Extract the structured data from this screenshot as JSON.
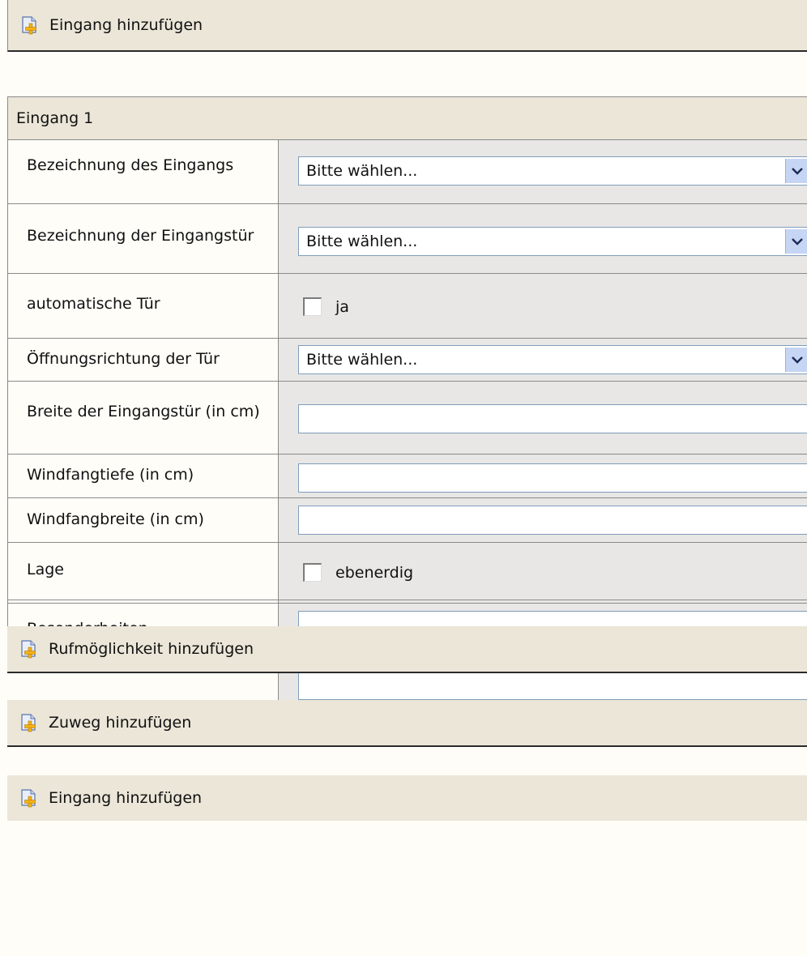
{
  "top_add": {
    "label": "Eingang hinzufügen",
    "icon": "add-document-icon"
  },
  "section": {
    "title": "Eingang 1",
    "rows": {
      "bezeichnung_eingang": {
        "label": "Bezeichnung des Eingangs",
        "value": "Bitte wählen..."
      },
      "bezeichnung_tuer": {
        "label": "Bezeichnung der Eingangstür",
        "value": "Bitte wählen..."
      },
      "automatische_tuer": {
        "label": "automatische Tür",
        "checkbox_label": "ja",
        "checked": false
      },
      "oeffnungsrichtung": {
        "label": "Öffnungsrichtung der Tür",
        "value": "Bitte wählen..."
      },
      "breite": {
        "label": "Breite der Eingangstür (in cm)",
        "value": ""
      },
      "windfangtiefe": {
        "label": "Windfangtiefe (in cm)",
        "value": ""
      },
      "windfangbreite": {
        "label": "Windfangbreite (in cm)",
        "value": ""
      },
      "lage": {
        "label": "Lage",
        "checkbox_label": "ebenerdig",
        "checked": false
      },
      "besonderheiten": {
        "label": "Besonderheiten",
        "value": ""
      }
    }
  },
  "bottom_actions": {
    "rufmoeglichkeit": "Rufmöglichkeit hinzufügen",
    "zuweg": "Zuweg hinzufügen",
    "eingang": "Eingang hinzufügen"
  },
  "colors": {
    "bar_bg": "#ebe6d8",
    "page_bg": "#fefdf7",
    "value_bg": "#e8e7e6",
    "input_border": "#7f9db9",
    "dropdown_arrow_bg": "#c6d5f4"
  }
}
